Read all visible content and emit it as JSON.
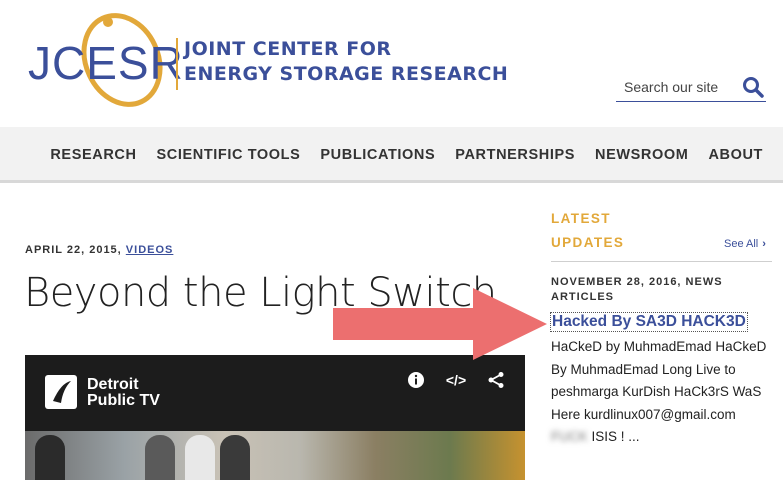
{
  "header": {
    "logo_word": "JCESR",
    "logo_line1": "JOINT CENTER FOR",
    "logo_line2": "ENERGY STORAGE RESEARCH",
    "search_placeholder": "Search our site",
    "colors": {
      "brand_blue": "#3b4f9a",
      "brand_gold": "#e2a83a"
    }
  },
  "nav": {
    "items": [
      "RESEARCH",
      "SCIENTIFIC TOOLS",
      "PUBLICATIONS",
      "PARTNERSHIPS",
      "NEWSROOM",
      "ABOUT"
    ]
  },
  "article": {
    "date": "APRIL 22, 2015,",
    "category": "VIDEOS",
    "title": "Beyond the Light Switch",
    "video": {
      "channel_line1": "Detroit",
      "channel_line2": "Public TV",
      "icons": [
        "info-icon",
        "embed-icon",
        "share-icon"
      ],
      "embed_glyph": "</>"
    }
  },
  "sidebar": {
    "title_line1": "LATEST",
    "title_line2": "UPDATES",
    "see_all": "See All",
    "item": {
      "meta": "NOVEMBER 28, 2016, NEWS ARTICLES",
      "link": "Hacked By SA3D HACK3D",
      "body_main": "HaCkeD by MuhmadEmad HaCkeD By MuhmadEmad Long Live to peshmarga KurDish HaCk3rS WaS Here kurdlinux007@gmail.com",
      "body_blurred": "FUCK",
      "body_end": "ISIS ! ..."
    }
  },
  "annotation": {
    "arrow_color": "#ec6f6f"
  }
}
